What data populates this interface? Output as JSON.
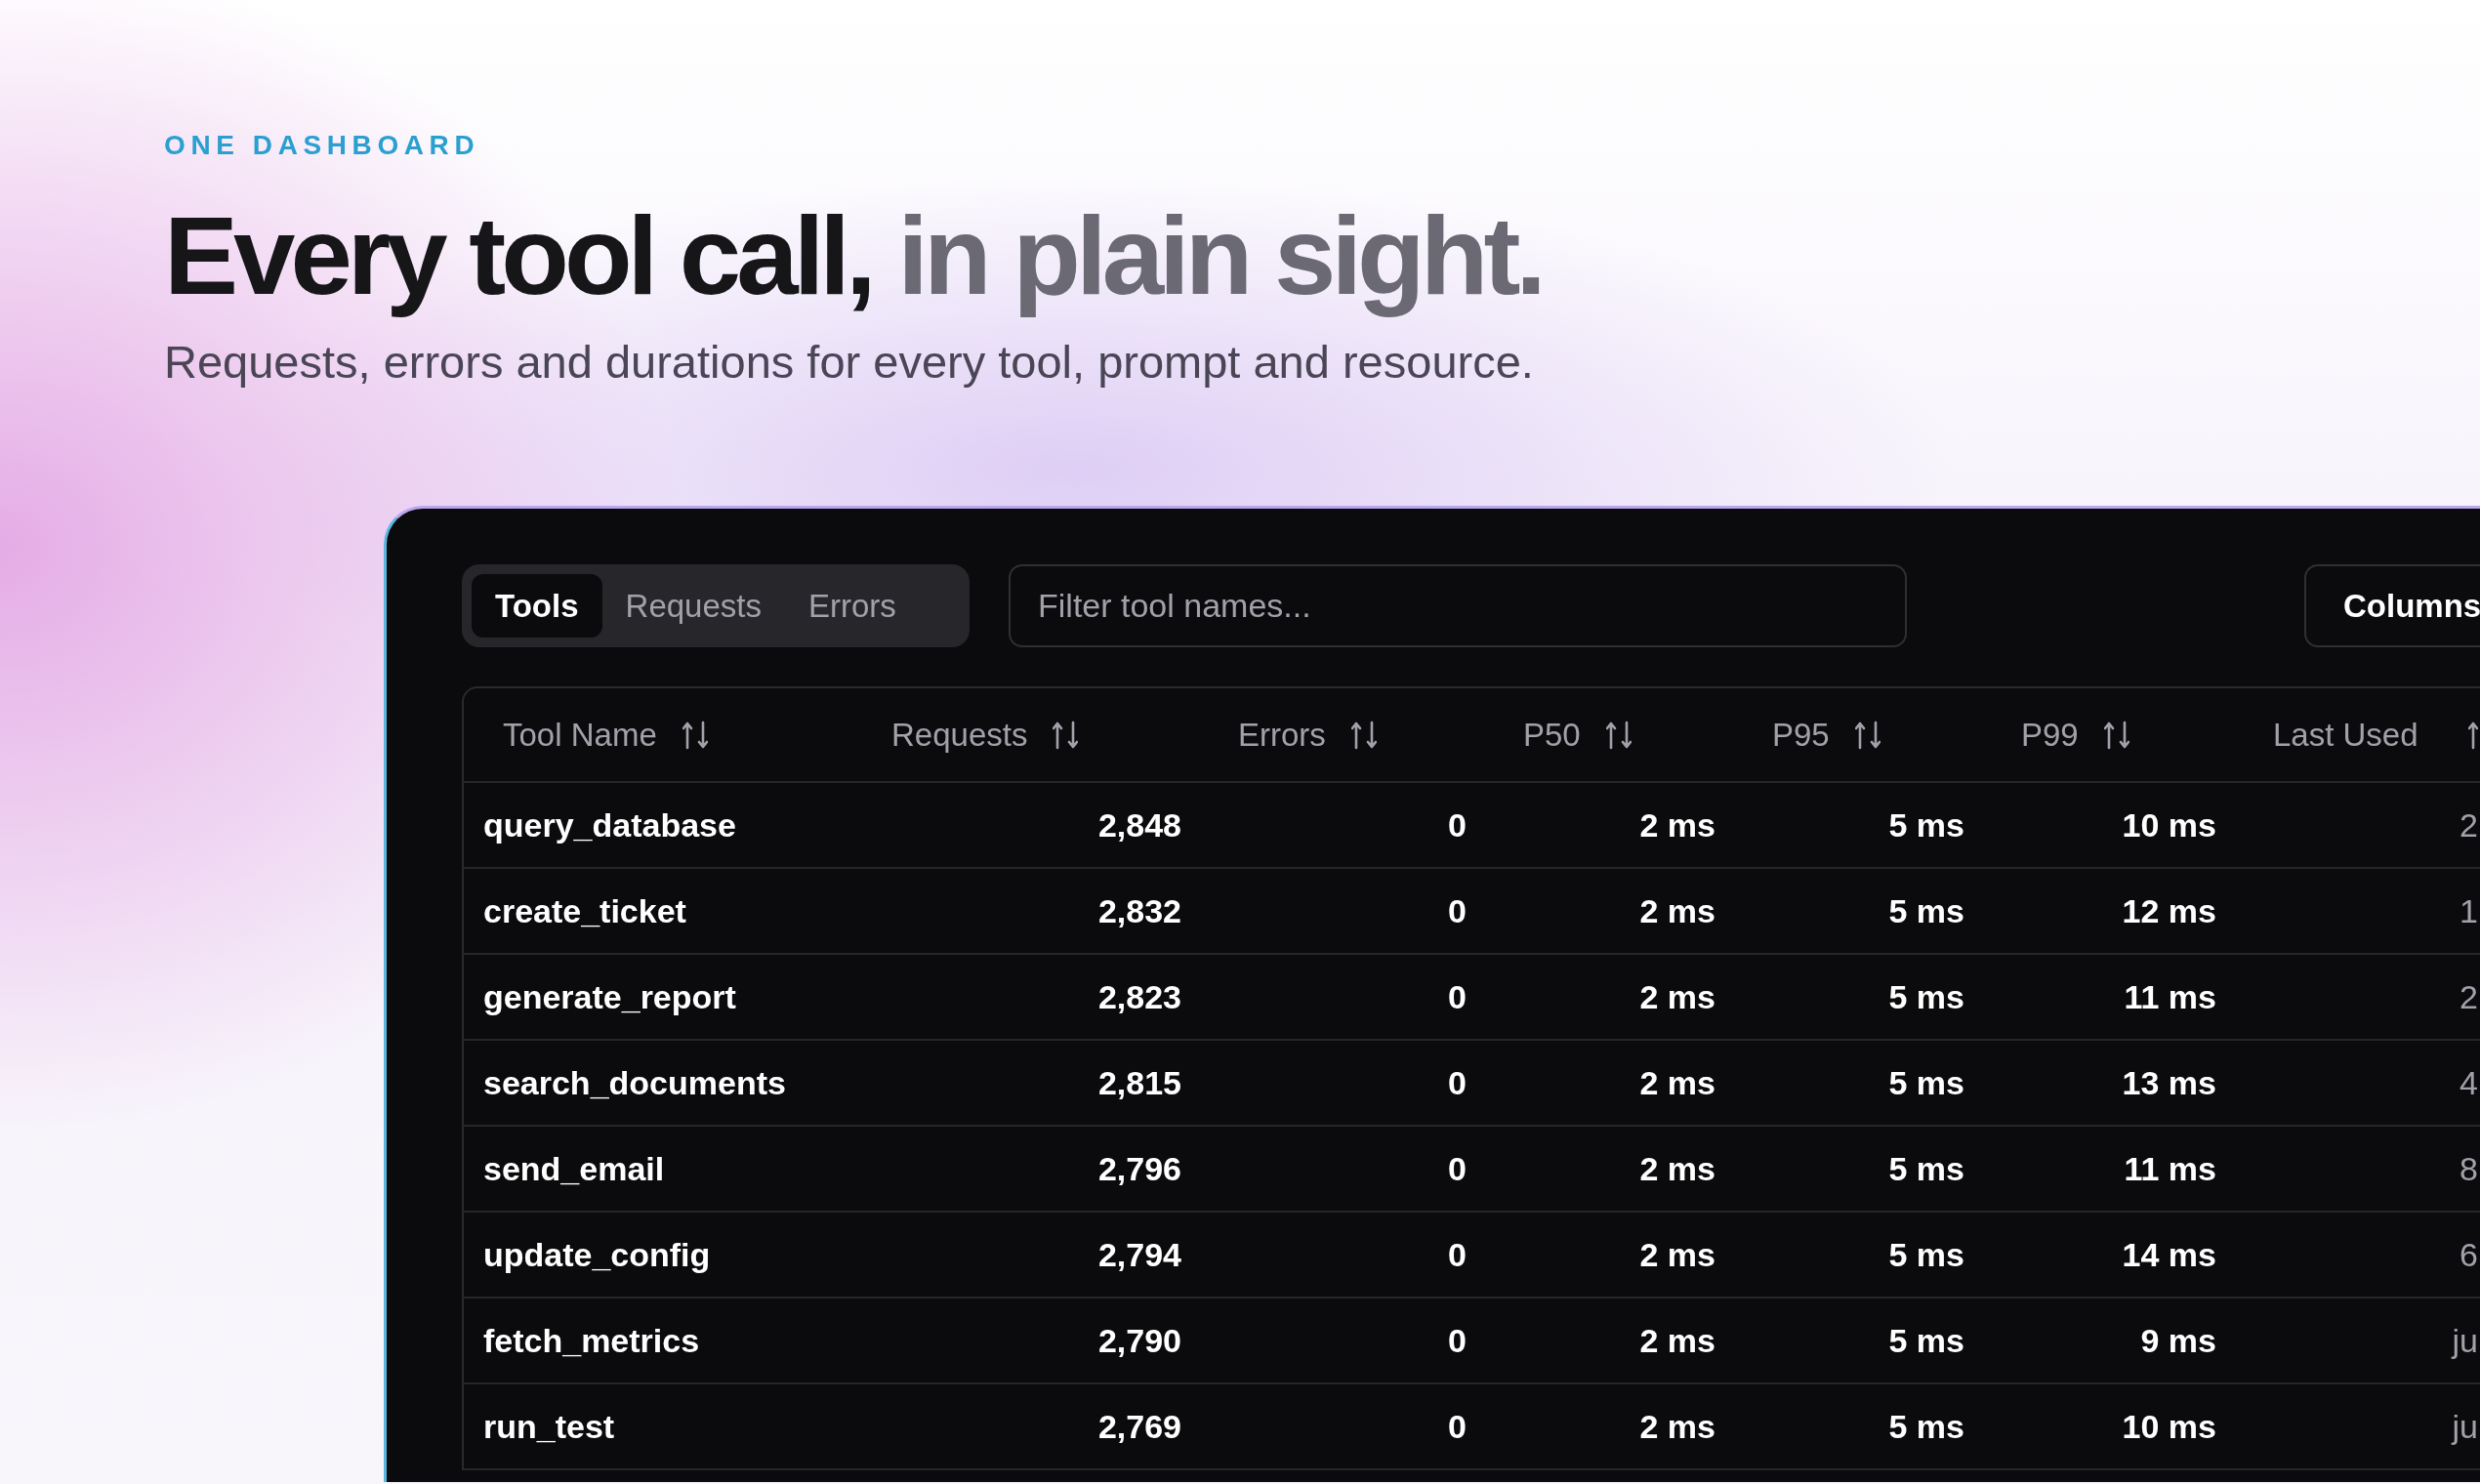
{
  "eyebrow": "ONE DASHBOARD",
  "headline": {
    "lead": "Every tool call,",
    "accent": "in plain sight."
  },
  "subtitle": "Requests, errors and durations for every tool, prompt and resource.",
  "tabs": [
    {
      "label": "Tools",
      "selected": true
    },
    {
      "label": "Requests",
      "selected": false
    },
    {
      "label": "Errors",
      "selected": false
    }
  ],
  "filter": {
    "placeholder": "Filter tool names..."
  },
  "columns_button": "Columns",
  "table": {
    "columns": [
      "Tool Name",
      "Requests",
      "Errors",
      "P50",
      "P95",
      "P99",
      "Last Used"
    ],
    "rows": [
      [
        "query_database",
        "2,848",
        "0",
        "2 ms",
        "5 ms",
        "10 ms",
        "2"
      ],
      [
        "create_ticket",
        "2,832",
        "0",
        "2 ms",
        "5 ms",
        "12 ms",
        "1"
      ],
      [
        "generate_report",
        "2,823",
        "0",
        "2 ms",
        "5 ms",
        "11 ms",
        "2"
      ],
      [
        "search_documents",
        "2,815",
        "0",
        "2 ms",
        "5 ms",
        "13 ms",
        "4"
      ],
      [
        "send_email",
        "2,796",
        "0",
        "2 ms",
        "5 ms",
        "11 ms",
        "8"
      ],
      [
        "update_config",
        "2,794",
        "0",
        "2 ms",
        "5 ms",
        "14 ms",
        "6"
      ],
      [
        "fetch_metrics",
        "2,790",
        "0",
        "2 ms",
        "5 ms",
        "9 ms",
        "ju"
      ],
      [
        "run_test",
        "2,769",
        "0",
        "2 ms",
        "5 ms",
        "10 ms",
        "ju"
      ]
    ]
  }
}
